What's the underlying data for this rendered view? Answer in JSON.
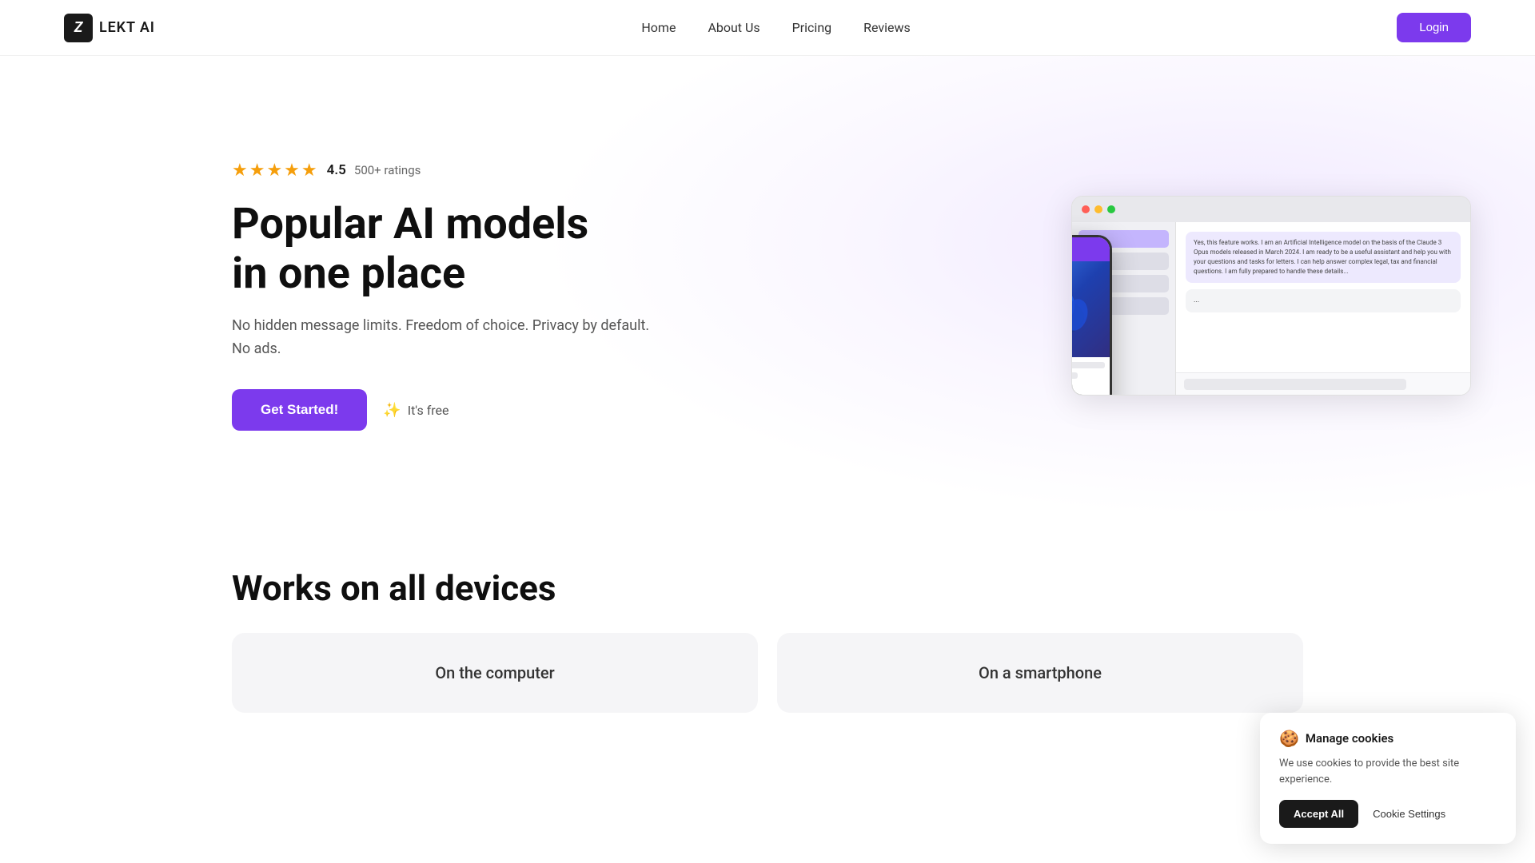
{
  "nav": {
    "logo_text": "LEKT AI",
    "links": [
      {
        "id": "home",
        "label": "Home"
      },
      {
        "id": "about",
        "label": "About Us"
      },
      {
        "id": "pricing",
        "label": "Pricing"
      },
      {
        "id": "reviews",
        "label": "Reviews"
      }
    ],
    "login_label": "Login"
  },
  "hero": {
    "rating": {
      "stars": "★★★★★",
      "score": "4.5",
      "count": "500+ ratings"
    },
    "title": "Popular AI models\nin one place",
    "subtitle": "No hidden message limits. Freedom of choice. Privacy by default. No ads.",
    "cta_button": "Get Started!",
    "free_label": "It's free"
  },
  "section2": {
    "title": "Works on all devices",
    "cards": [
      {
        "label": "On the computer"
      },
      {
        "label": "On a smartphone"
      }
    ]
  },
  "cookie": {
    "emoji": "🍪",
    "title": "Manage cookies",
    "text": "We use cookies to provide the best site experience.",
    "accept_label": "Accept All",
    "settings_label": "Cookie Settings"
  }
}
